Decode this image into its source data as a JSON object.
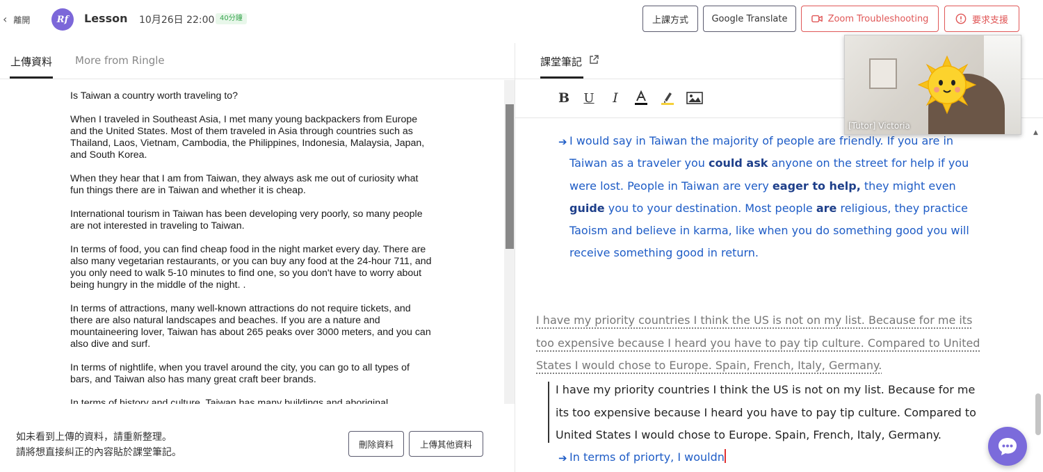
{
  "header": {
    "back_label": "離開",
    "logo_text": "Rf",
    "title": "Lesson",
    "datetime": "10月26日 22:00",
    "duration": "40分鐘",
    "buttons": {
      "class_method": "上課方式",
      "google_translate": "Google Translate",
      "zoom_troubleshooting": "Zoom Troubleshooting",
      "request_support": "要求支援"
    }
  },
  "left_panel": {
    "tabs": [
      "上傳資料",
      "More from Ringle"
    ],
    "active_tab": "上傳資料",
    "document": {
      "paragraphs": [
        "Is Taiwan a country worth traveling to?",
        "When I traveled in Southeast Asia, I met many young backpackers from Europe and the United States. Most of them traveled in Asia through countries such as Thailand, Laos, Vietnam, Cambodia, the Philippines, Indonesia, Malaysia, Japan, and South Korea.",
        "When they hear that I am from Taiwan, they always ask me out of curiosity what fun things there are in Taiwan and whether it is cheap.",
        "International tourism in Taiwan has been developing very poorly, so many people are not interested in traveling to Taiwan.",
        "In terms of food, you can find cheap food in the night market every day. There are also many vegetarian restaurants, or you can buy any food at the 24-hour 711, and you only need to walk 5-10 minutes to find one, so you don't have to worry about being hungry in the middle of the night. .",
        "In terms of attractions, many well-known attractions do not require tickets, and there are also natural landscapes and beaches. If you are a nature and mountaineering lover, Taiwan has about 265 peaks over 3000 meters, and you can also dive and surf.",
        "In terms of nightlife, when you travel around the city, you can go to all types of bars, and Taiwan also has many great craft beer brands.",
        "In terms of history and culture, Taiwan has many buildings and aboriginal"
      ]
    },
    "footer": {
      "note_line1": "如未看到上傳的資料，請重新整理。",
      "note_line2": "請將想直接糾正的內容貼於課堂筆記。",
      "delete_button": "刪除資料",
      "upload_button": "上傳其他資料"
    }
  },
  "right_panel": {
    "tab": "課堂筆記",
    "toolbar": [
      "bold",
      "underline",
      "italic",
      "text-color",
      "highlight",
      "image"
    ],
    "notes": {
      "blue_1": {
        "segments": [
          {
            "t": "I would say in Taiwan the majority of people are friendly. If you are in Taiwan as a traveler you ",
            "b": false
          },
          {
            "t": "could ask",
            "b": true
          },
          {
            "t": " anyone on the street for help if you were lost. People in Taiwan are very ",
            "b": false
          },
          {
            "t": "eager to help,",
            "b": true
          },
          {
            "t": " they might even ",
            "b": false
          },
          {
            "t": "guide",
            "b": true
          },
          {
            "t": " you to your destination.  Most people ",
            "b": false
          },
          {
            "t": "are",
            "b": true
          },
          {
            "t": " religious, they practice Taoism and believe in karma, like when you do something good you will receive something good in return.",
            "b": false
          }
        ]
      },
      "student_text": "I have my priority countries I think the US is not on my list. Because for me its too expensive because I heard you have to pay tip culture. Compared to United States I would chose to Europe. Spain, French, Italy, Germany.",
      "quoted_text": "I have my priority countries I think the US is not on my list. Because for me its too expensive because I heard you have to pay tip culture. Compared to United States I would chose to Europe. Spain, French, Italy, Germany.",
      "blue_2": "In terms of priorty, I wouldn"
    }
  },
  "video": {
    "label": "[Tutor] Victoria"
  },
  "colors": {
    "accent_purple": "#7b6bdb",
    "note_blue": "#1e5cc6",
    "danger_red": "#e05757",
    "badge_green": "#3aa651"
  }
}
